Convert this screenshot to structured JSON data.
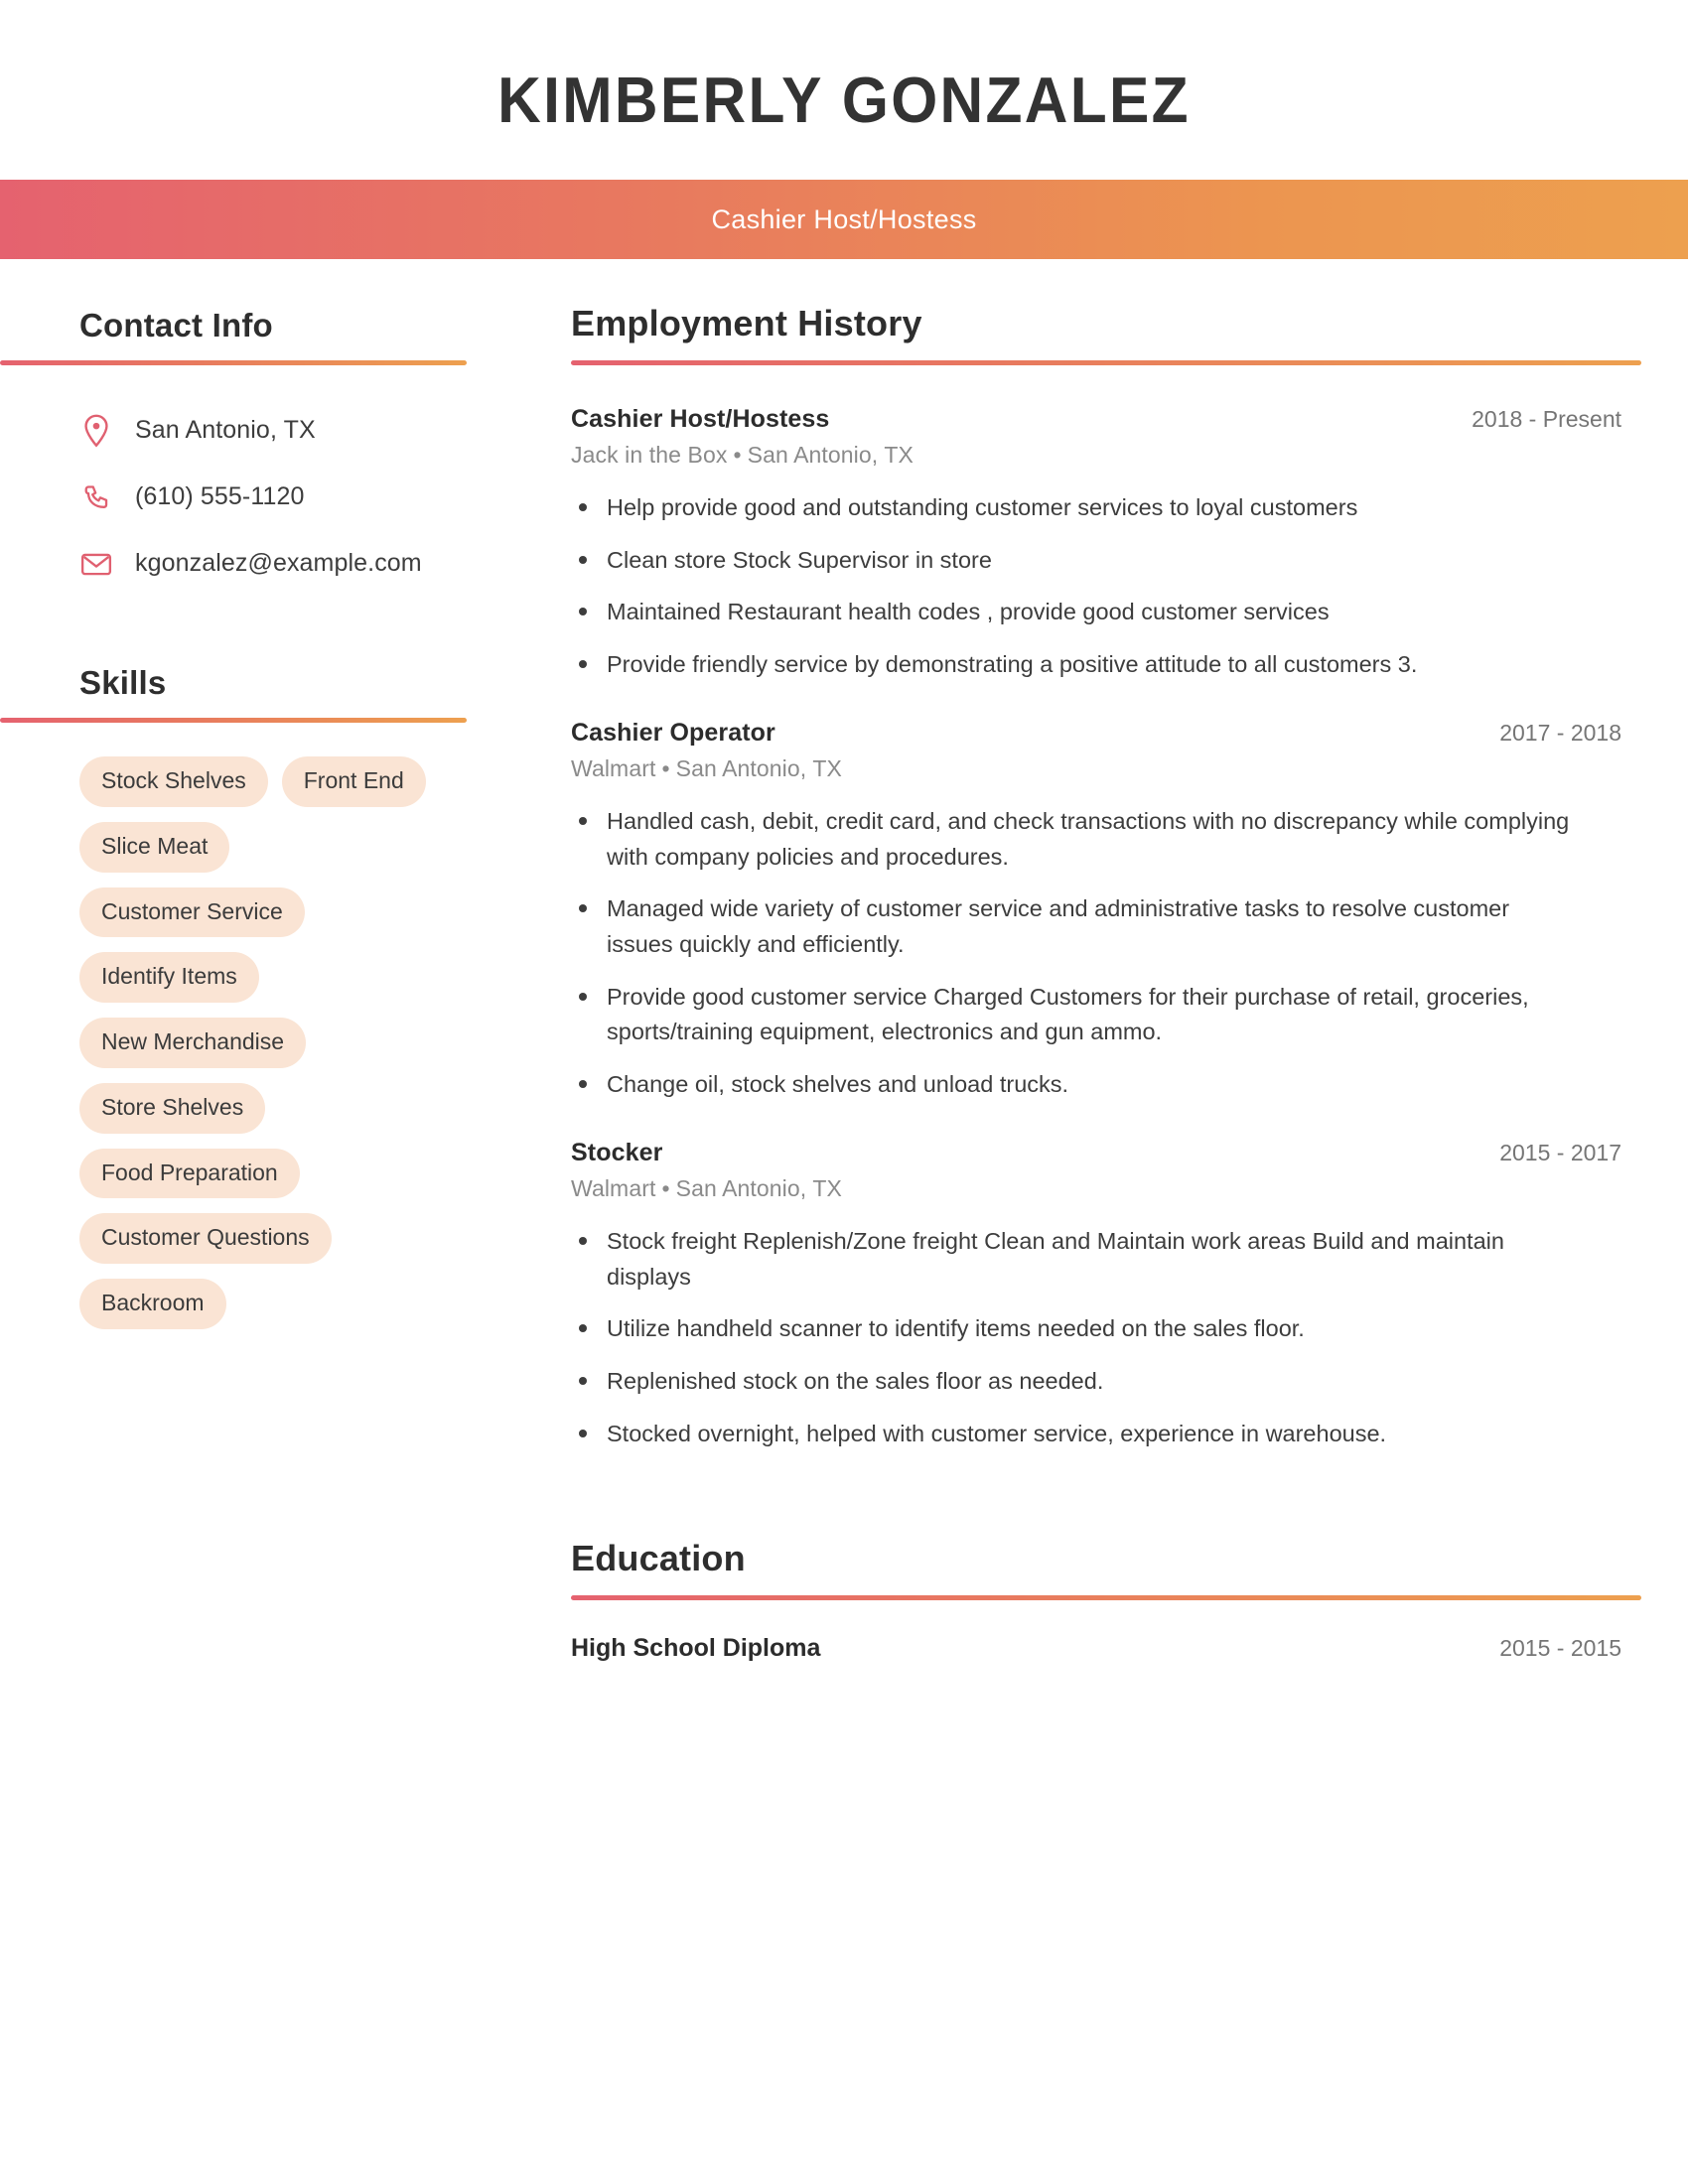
{
  "header": {
    "name": "KIMBERLY GONZALEZ",
    "job_title": "Cashier Host/Hostess",
    "accent_start": "#e5626f",
    "accent_end": "#eda04f"
  },
  "sidebar": {
    "contact": {
      "heading": "Contact Info",
      "items": [
        {
          "icon": "location-pin-icon",
          "value": "San Antonio, TX"
        },
        {
          "icon": "phone-icon",
          "value": "(610) 555-1120"
        },
        {
          "icon": "envelope-icon",
          "value": "kgonzalez@example.com"
        }
      ]
    },
    "skills": {
      "heading": "Skills",
      "pill_color": "#fae4d4",
      "items": [
        "Stock Shelves",
        "Front End",
        "Slice Meat",
        "Customer Service",
        "Identify Items",
        "New Merchandise",
        "Store Shelves",
        "Food Preparation",
        "Customer Questions",
        "Backroom"
      ]
    }
  },
  "main": {
    "employment": {
      "heading": "Employment History",
      "jobs": [
        {
          "role": "Cashier Host/Hostess",
          "dates": "2018 - Present",
          "company": "Jack in the Box",
          "location": "San Antonio, TX",
          "bullets": [
            "Help provide good and outstanding customer services to loyal customers",
            "Clean store Stock Supervisor in store",
            "Maintained Restaurant health codes , provide good customer services",
            "Provide friendly service by demonstrating a positive attitude to all customers 3."
          ]
        },
        {
          "role": "Cashier Operator",
          "dates": "2017 - 2018",
          "company": "Walmart",
          "location": "San Antonio, TX",
          "bullets": [
            "Handled cash, debit, credit card, and check transactions with no discrepancy while complying with company policies and procedures.",
            "Managed wide variety of customer service and administrative tasks to resolve customer issues quickly and efficiently.",
            "Provide good customer service Charged Customers for their purchase of retail, groceries, sports/training equipment, electronics and gun ammo.",
            "Change oil, stock shelves and unload trucks."
          ]
        },
        {
          "role": "Stocker",
          "dates": "2015 - 2017",
          "company": "Walmart",
          "location": "San Antonio, TX",
          "bullets": [
            "Stock freight Replenish/Zone freight Clean and Maintain work areas Build and maintain displays",
            "Utilize handheld scanner to identify items needed on the sales floor.",
            "Replenished stock on the sales floor as needed.",
            "Stocked overnight, helped with customer service, experience in warehouse."
          ]
        }
      ]
    },
    "education": {
      "heading": "Education",
      "entries": [
        {
          "degree": "High School Diploma",
          "dates": "2015 - 2015"
        }
      ]
    }
  },
  "separator": "•"
}
